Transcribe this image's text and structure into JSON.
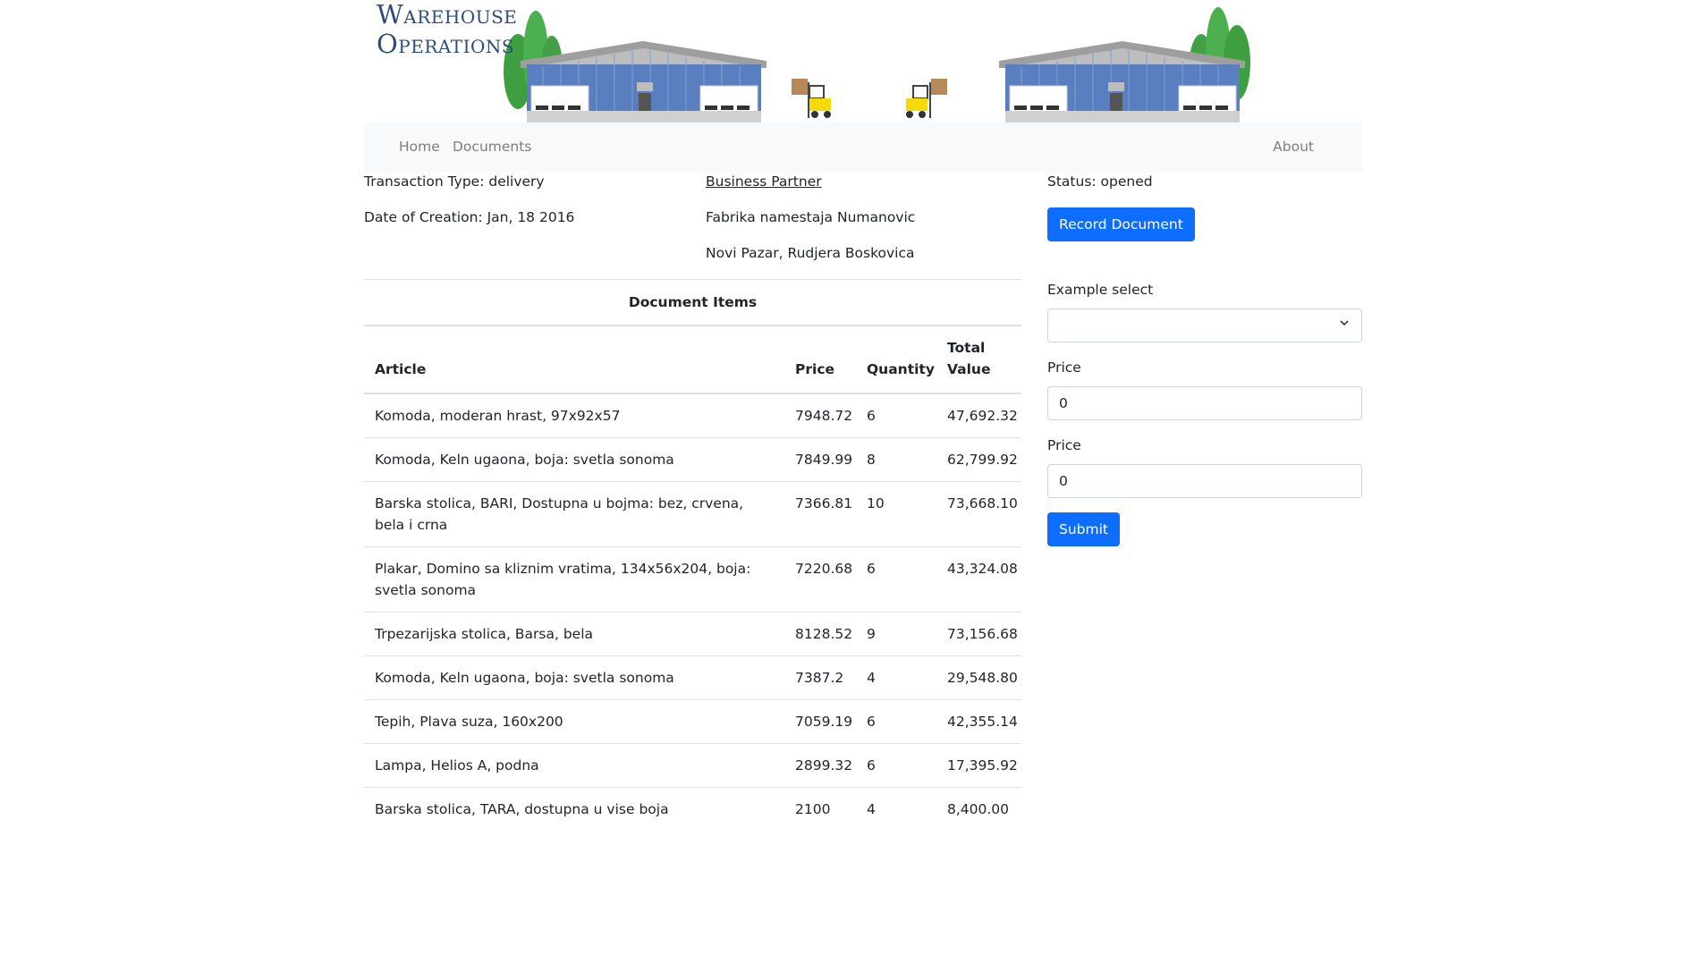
{
  "brand": {
    "line1": "Warehouse",
    "line2": "Operations",
    "colors": {
      "logo": "#2d4d7c",
      "building": "#5a7fc1",
      "roof": "#8e8e8e",
      "tree": "#4caf50",
      "forklift": "#f5d90a"
    }
  },
  "nav": {
    "home": "Home",
    "documents": "Documents",
    "about": "About"
  },
  "document": {
    "transaction_type": "Transaction Type: delivery",
    "date_of_creation": "Date of Creation: Jan, 18 2016",
    "partner_label": "Business Partner",
    "partner_name": "Fabrika namestaja Numanovic",
    "partner_address": "Novi Pazar, Rudjera Boskovica",
    "status": "Status: opened",
    "record_button": "Record Document"
  },
  "items": {
    "title": "Document Items",
    "columns": {
      "article": "Article",
      "price": "Price",
      "quantity": "Quantity",
      "total_value": "Total Value"
    },
    "rows": [
      {
        "article": "Komoda, moderan hrast, 97x92x57",
        "price": "7948.72",
        "quantity": "6",
        "total": "47,692.32"
      },
      {
        "article": "Komoda, Keln ugaona, boja: svetla sonoma",
        "price": "7849.99",
        "quantity": "8",
        "total": "62,799.92"
      },
      {
        "article": "Barska stolica, BARI, Dostupna u bojma: bez, crvena, bela i crna",
        "price": "7366.81",
        "quantity": "10",
        "total": "73,668.10"
      },
      {
        "article": "Plakar, Domino sa kliznim vratima, 134x56x204, boja: svetla sonoma",
        "price": "7220.68",
        "quantity": "6",
        "total": "43,324.08"
      },
      {
        "article": "Trpezarijska stolica, Barsa, bela",
        "price": "8128.52",
        "quantity": "9",
        "total": "73,156.68"
      },
      {
        "article": "Komoda, Keln ugaona, boja: svetla sonoma",
        "price": "7387.2",
        "quantity": "4",
        "total": "29,548.80"
      },
      {
        "article": "Tepih, Plava suza, 160x200",
        "price": "7059.19",
        "quantity": "6",
        "total": "42,355.14"
      },
      {
        "article": "Lampa, Helios A, podna",
        "price": "2899.32",
        "quantity": "6",
        "total": "17,395.92"
      },
      {
        "article": "Barska stolica, TARA, dostupna u vise boja",
        "price": "2100",
        "quantity": "4",
        "total": "8,400.00"
      }
    ]
  },
  "form": {
    "select_label": "Example select",
    "select_value": "",
    "price_label_1": "Price",
    "price_value_1": "0",
    "price_label_2": "Price",
    "price_value_2": "0",
    "submit": "Submit",
    "colors": {
      "primary": "#0d6efd"
    }
  }
}
